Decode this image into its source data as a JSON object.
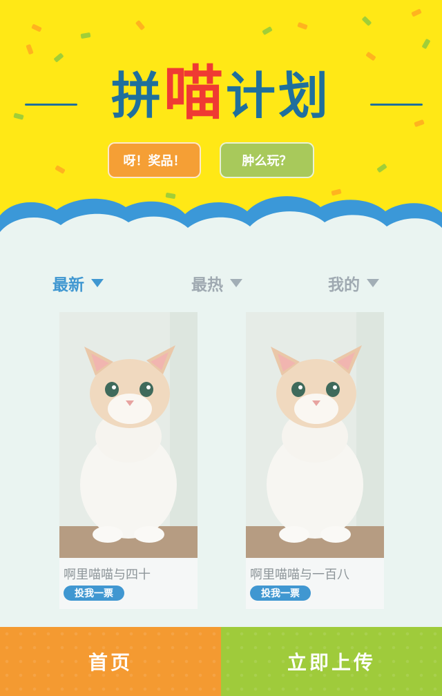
{
  "hero": {
    "title_part1": "拼",
    "title_part2": "喵",
    "title_part3": "计划",
    "prize_button": "呀！奖品！",
    "how_button": "肿么玩？",
    "colors": {
      "background": "#ffe816",
      "title_blue": "#1f6f9d",
      "title_red": "#ef3a33"
    }
  },
  "tabs": [
    {
      "label": "最新",
      "active": true
    },
    {
      "label": "最热",
      "active": false
    },
    {
      "label": "我的",
      "active": false
    }
  ],
  "cards": [
    {
      "caption": "啊里喵喵与四十",
      "vote_label": "投我一票",
      "photo": "white-kitten-photo"
    },
    {
      "caption": "啊里喵喵与一百八",
      "vote_label": "投我一票",
      "photo": "white-kitten-photo"
    }
  ],
  "bottom_nav": {
    "home": "首页",
    "upload": "立即上传",
    "colors": {
      "home": "#f49a31",
      "upload": "#9fcb3b"
    }
  },
  "icons": {
    "tab_indicator": "caret-down-icon"
  }
}
